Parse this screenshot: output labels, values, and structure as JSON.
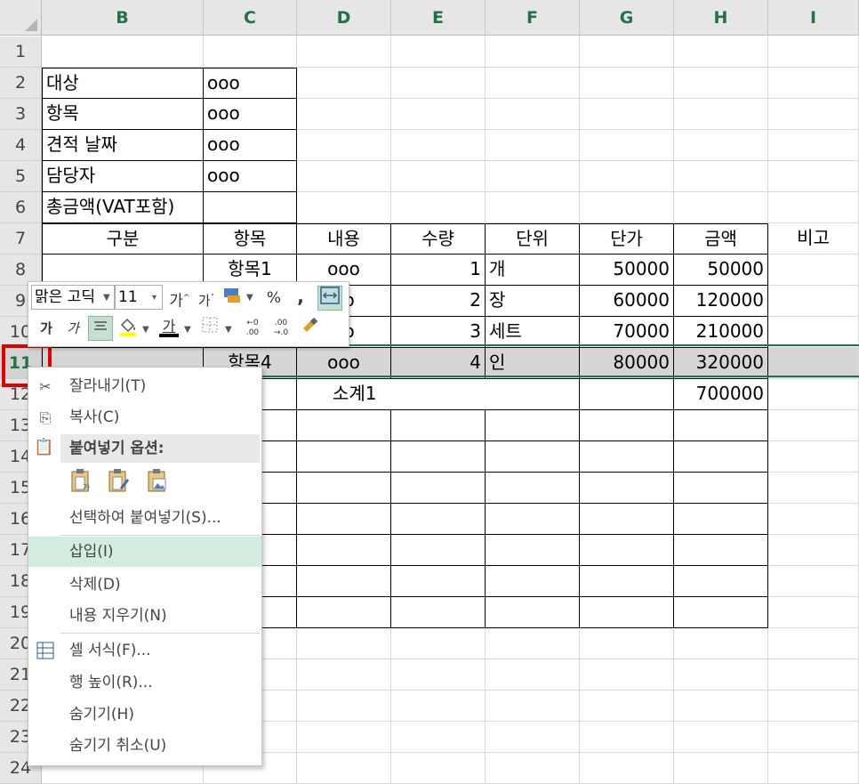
{
  "columns": [
    "B",
    "C",
    "D",
    "E",
    "F",
    "G",
    "H",
    "I"
  ],
  "rows": [
    "1",
    "2",
    "3",
    "4",
    "5",
    "6",
    "7",
    "8",
    "9",
    "10",
    "11",
    "12",
    "13",
    "14",
    "15",
    "16",
    "17",
    "18",
    "19",
    "20",
    "21",
    "22",
    "23",
    "24"
  ],
  "cells": {
    "B2": "대상",
    "C2": "ooo",
    "B3": "항목",
    "C3": "ooo",
    "B4": "견적 날짜",
    "C4": "ooo",
    "B5": "담당자",
    "C5": "ooo",
    "B6": "총금액(VAT포함)",
    "B7": "구분",
    "C7": "항목",
    "D7": "내용",
    "E7": "수량",
    "F7": "단위",
    "G7": "단가",
    "H7": "금액",
    "I7": "비고",
    "C8": "항목1",
    "D8": "ooo",
    "E8": "1",
    "F8": "개",
    "G8": "50000",
    "H8": "50000",
    "D9": "oo",
    "E9": "2",
    "F9": "장",
    "G9": "60000",
    "H9": "120000",
    "D10": "oo",
    "E10": "3",
    "F10": "세트",
    "G10": "70000",
    "H10": "210000",
    "C11": "항목4",
    "D11": "ooo",
    "E11": "4",
    "F11": "인",
    "G11": "80000",
    "H11": "320000",
    "D12": "소계1",
    "H12": "700000"
  },
  "mini_toolbar": {
    "font_name": "맑은 고딕",
    "font_size": "11",
    "grow_font": "가",
    "shrink_font": "가",
    "percent": "%",
    "comma": ",",
    "bold": "가",
    "italic": "가",
    "font_color_letter": "가",
    "inc_decimal_top": "←0",
    "inc_decimal_bottom": ".00",
    "dec_decimal_top": ".00",
    "dec_decimal_bottom": "→.0"
  },
  "context_menu": {
    "cut": "잘라내기(T)",
    "copy": "복사(C)",
    "paste_options": "붙여넣기 옵션:",
    "paste_special": "선택하여 붙여넣기(S)...",
    "insert": "삽입(I)",
    "delete": "삭제(D)",
    "clear": "내용 지우기(N)",
    "format_cells": "셀 서식(F)...",
    "row_height": "행 높이(R)...",
    "hide": "숨기기(H)",
    "unhide": "숨기기 취소(U)"
  },
  "colors": {
    "excel_green": "#217346",
    "highlight": "#d3ecde",
    "selection_box": "#e00000"
  }
}
